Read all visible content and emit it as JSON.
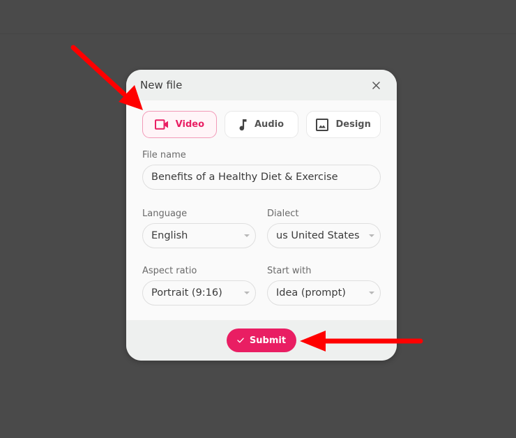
{
  "dialog": {
    "title": "New file",
    "close_icon": "close-icon",
    "file_types": [
      {
        "label": "Video",
        "icon": "video-camera-icon",
        "selected": true
      },
      {
        "label": "Audio",
        "icon": "music-note-icon",
        "selected": false
      },
      {
        "label": "Design",
        "icon": "image-icon",
        "selected": false
      }
    ],
    "file_name": {
      "label": "File name",
      "value": "Benefits of a Healthy Diet & Exercise"
    },
    "language": {
      "label": "Language",
      "value": "English"
    },
    "dialect": {
      "label": "Dialect",
      "value": "us United States"
    },
    "aspect_ratio": {
      "label": "Aspect ratio",
      "value": "Portrait (9:16)"
    },
    "start_with": {
      "label": "Start with",
      "value": "Idea (prompt)"
    },
    "submit": {
      "label": "Submit",
      "icon": "check-icon"
    }
  },
  "colors": {
    "accent": "#e91e63",
    "backdrop": "#4a4a4a",
    "annotation_arrow": "#ff0000"
  }
}
